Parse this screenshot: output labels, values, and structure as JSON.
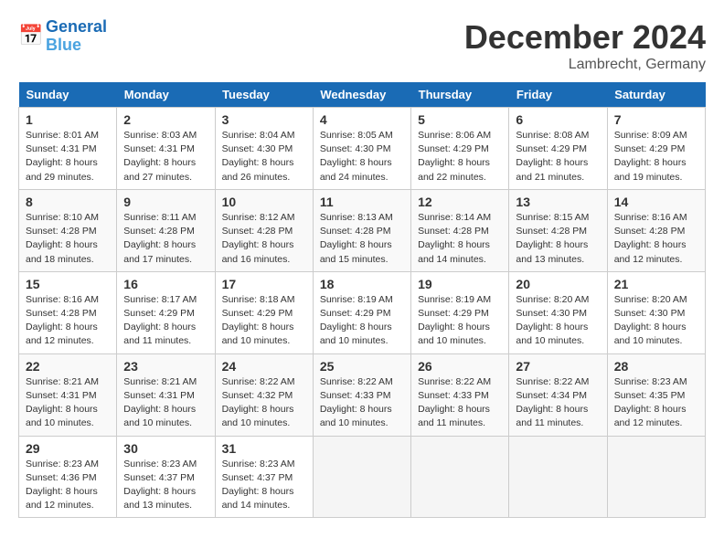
{
  "header": {
    "logo_line1": "General",
    "logo_line2": "Blue",
    "month": "December 2024",
    "location": "Lambrecht, Germany"
  },
  "days_of_week": [
    "Sunday",
    "Monday",
    "Tuesday",
    "Wednesday",
    "Thursday",
    "Friday",
    "Saturday"
  ],
  "weeks": [
    [
      {
        "day": 1,
        "sunrise": "8:01 AM",
        "sunset": "4:31 PM",
        "daylight": "8 hours and 29 minutes."
      },
      {
        "day": 2,
        "sunrise": "8:03 AM",
        "sunset": "4:31 PM",
        "daylight": "8 hours and 27 minutes."
      },
      {
        "day": 3,
        "sunrise": "8:04 AM",
        "sunset": "4:30 PM",
        "daylight": "8 hours and 26 minutes."
      },
      {
        "day": 4,
        "sunrise": "8:05 AM",
        "sunset": "4:30 PM",
        "daylight": "8 hours and 24 minutes."
      },
      {
        "day": 5,
        "sunrise": "8:06 AM",
        "sunset": "4:29 PM",
        "daylight": "8 hours and 22 minutes."
      },
      {
        "day": 6,
        "sunrise": "8:08 AM",
        "sunset": "4:29 PM",
        "daylight": "8 hours and 21 minutes."
      },
      {
        "day": 7,
        "sunrise": "8:09 AM",
        "sunset": "4:29 PM",
        "daylight": "8 hours and 19 minutes."
      }
    ],
    [
      {
        "day": 8,
        "sunrise": "8:10 AM",
        "sunset": "4:28 PM",
        "daylight": "8 hours and 18 minutes."
      },
      {
        "day": 9,
        "sunrise": "8:11 AM",
        "sunset": "4:28 PM",
        "daylight": "8 hours and 17 minutes."
      },
      {
        "day": 10,
        "sunrise": "8:12 AM",
        "sunset": "4:28 PM",
        "daylight": "8 hours and 16 minutes."
      },
      {
        "day": 11,
        "sunrise": "8:13 AM",
        "sunset": "4:28 PM",
        "daylight": "8 hours and 15 minutes."
      },
      {
        "day": 12,
        "sunrise": "8:14 AM",
        "sunset": "4:28 PM",
        "daylight": "8 hours and 14 minutes."
      },
      {
        "day": 13,
        "sunrise": "8:15 AM",
        "sunset": "4:28 PM",
        "daylight": "8 hours and 13 minutes."
      },
      {
        "day": 14,
        "sunrise": "8:16 AM",
        "sunset": "4:28 PM",
        "daylight": "8 hours and 12 minutes."
      }
    ],
    [
      {
        "day": 15,
        "sunrise": "8:16 AM",
        "sunset": "4:28 PM",
        "daylight": "8 hours and 12 minutes."
      },
      {
        "day": 16,
        "sunrise": "8:17 AM",
        "sunset": "4:29 PM",
        "daylight": "8 hours and 11 minutes."
      },
      {
        "day": 17,
        "sunrise": "8:18 AM",
        "sunset": "4:29 PM",
        "daylight": "8 hours and 10 minutes."
      },
      {
        "day": 18,
        "sunrise": "8:19 AM",
        "sunset": "4:29 PM",
        "daylight": "8 hours and 10 minutes."
      },
      {
        "day": 19,
        "sunrise": "8:19 AM",
        "sunset": "4:29 PM",
        "daylight": "8 hours and 10 minutes."
      },
      {
        "day": 20,
        "sunrise": "8:20 AM",
        "sunset": "4:30 PM",
        "daylight": "8 hours and 10 minutes."
      },
      {
        "day": 21,
        "sunrise": "8:20 AM",
        "sunset": "4:30 PM",
        "daylight": "8 hours and 10 minutes."
      }
    ],
    [
      {
        "day": 22,
        "sunrise": "8:21 AM",
        "sunset": "4:31 PM",
        "daylight": "8 hours and 10 minutes."
      },
      {
        "day": 23,
        "sunrise": "8:21 AM",
        "sunset": "4:31 PM",
        "daylight": "8 hours and 10 minutes."
      },
      {
        "day": 24,
        "sunrise": "8:22 AM",
        "sunset": "4:32 PM",
        "daylight": "8 hours and 10 minutes."
      },
      {
        "day": 25,
        "sunrise": "8:22 AM",
        "sunset": "4:33 PM",
        "daylight": "8 hours and 10 minutes."
      },
      {
        "day": 26,
        "sunrise": "8:22 AM",
        "sunset": "4:33 PM",
        "daylight": "8 hours and 11 minutes."
      },
      {
        "day": 27,
        "sunrise": "8:22 AM",
        "sunset": "4:34 PM",
        "daylight": "8 hours and 11 minutes."
      },
      {
        "day": 28,
        "sunrise": "8:23 AM",
        "sunset": "4:35 PM",
        "daylight": "8 hours and 12 minutes."
      }
    ],
    [
      {
        "day": 29,
        "sunrise": "8:23 AM",
        "sunset": "4:36 PM",
        "daylight": "8 hours and 12 minutes."
      },
      {
        "day": 30,
        "sunrise": "8:23 AM",
        "sunset": "4:37 PM",
        "daylight": "8 hours and 13 minutes."
      },
      {
        "day": 31,
        "sunrise": "8:23 AM",
        "sunset": "4:37 PM",
        "daylight": "8 hours and 14 minutes."
      },
      null,
      null,
      null,
      null
    ]
  ]
}
